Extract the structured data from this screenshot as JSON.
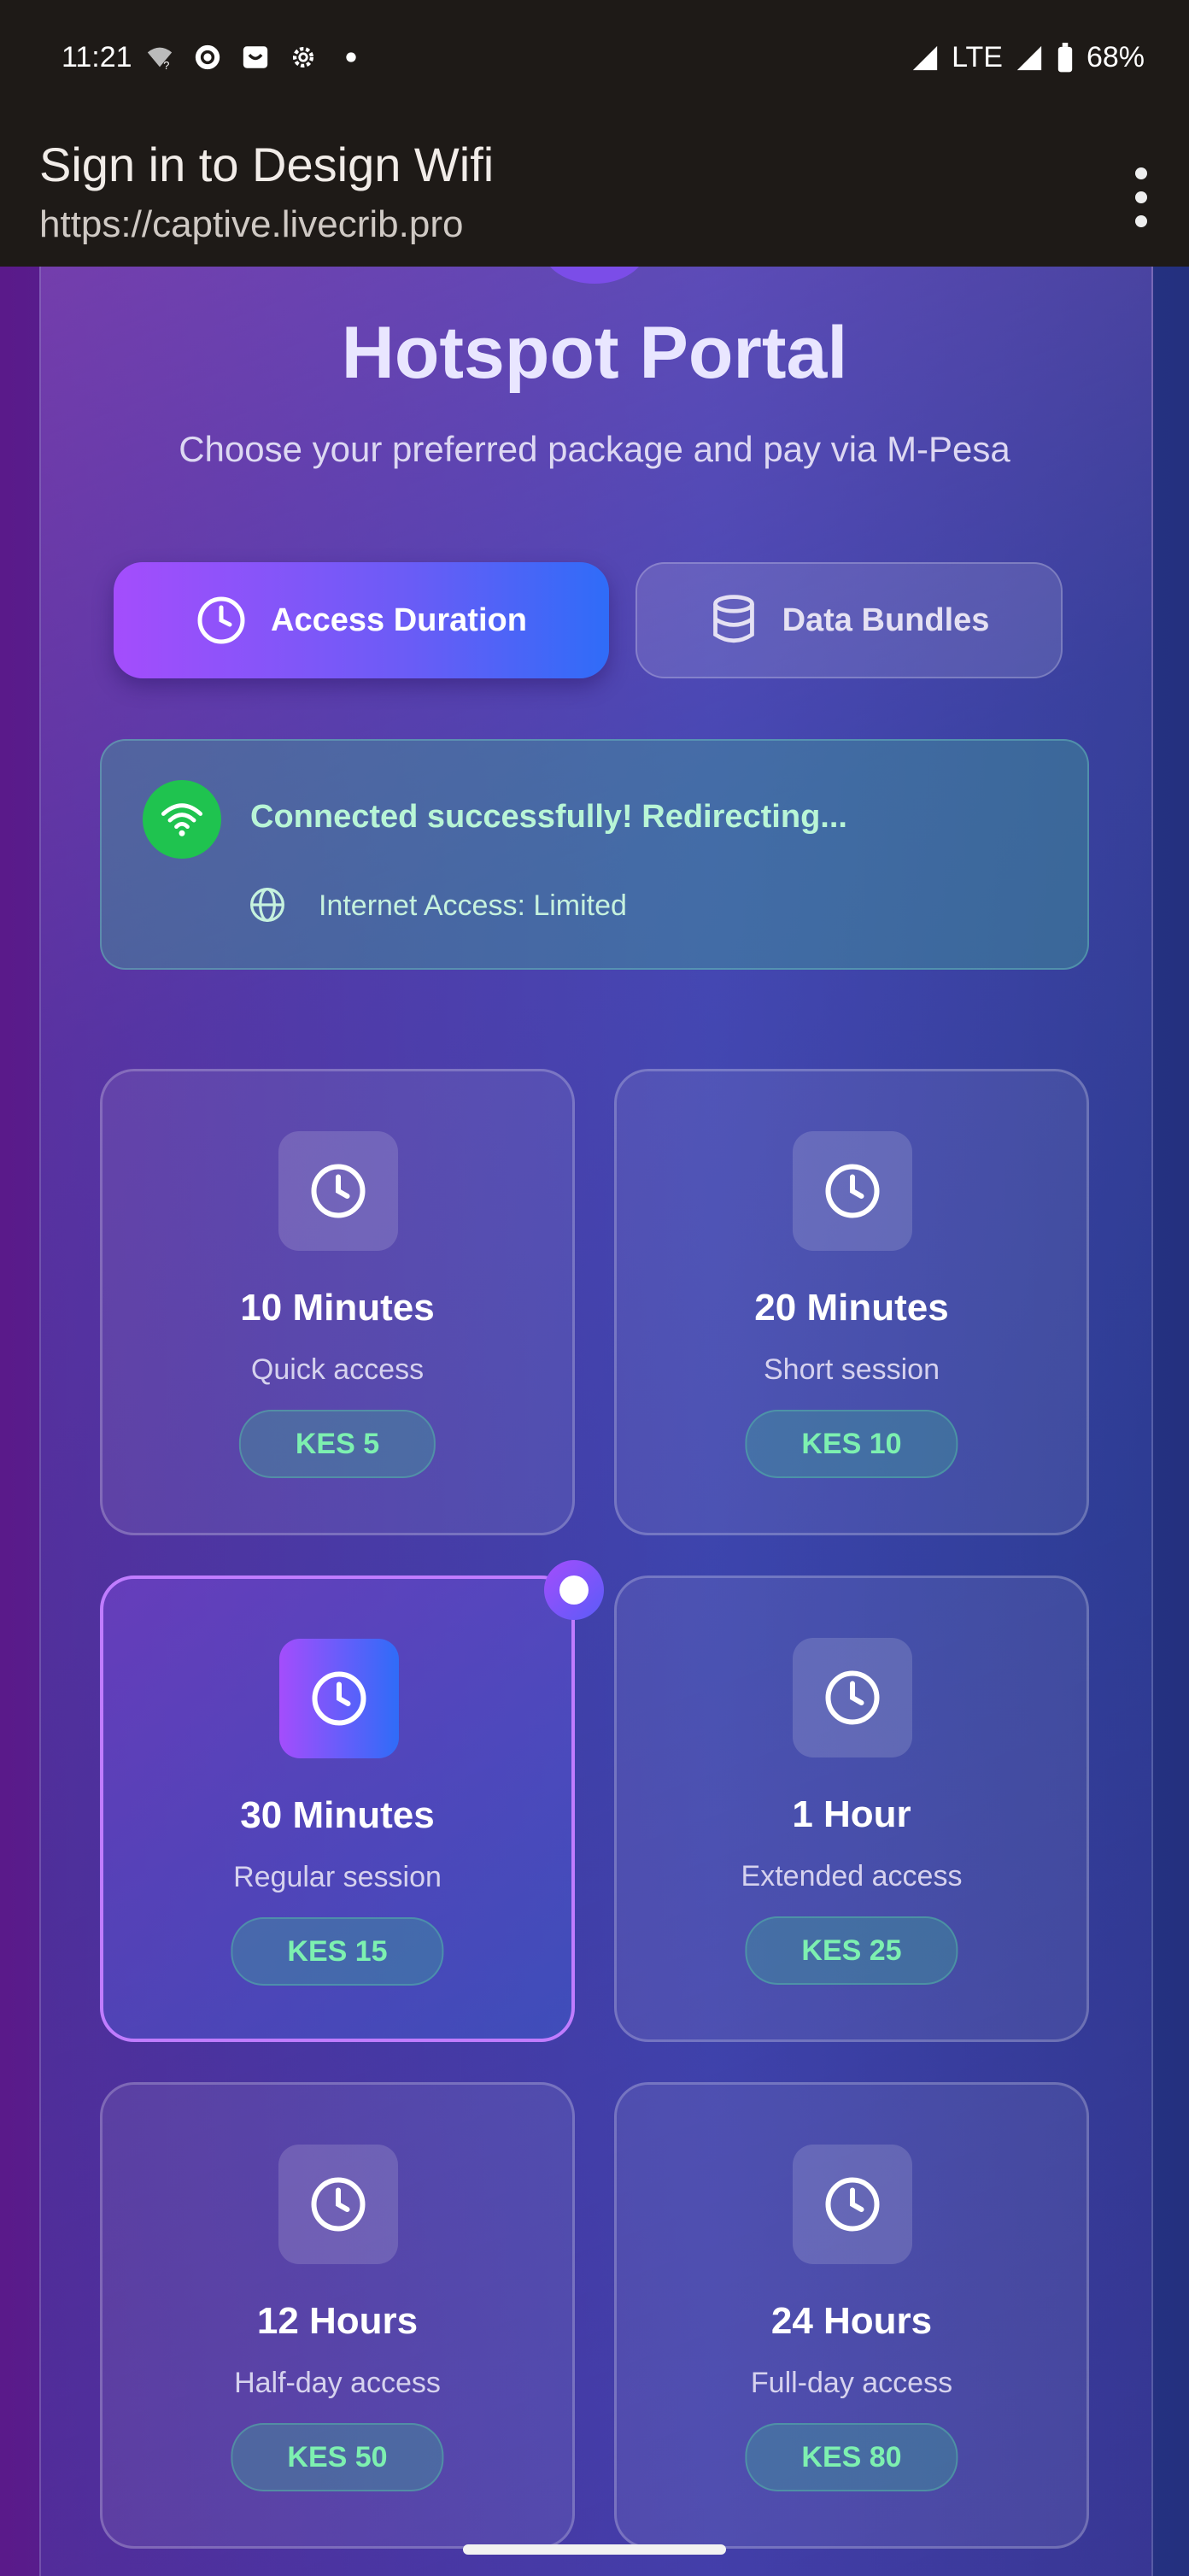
{
  "status_bar": {
    "time": "11:21",
    "network": "LTE",
    "battery": "68%",
    "icons": [
      "wifi-question-icon",
      "circle-icon",
      "shop-icon",
      "gear-icon",
      "dot-icon"
    ]
  },
  "browser": {
    "title": "Sign in to Design Wifi",
    "url": "https://captive.livecrib.pro"
  },
  "portal": {
    "title": "Hotspot Portal",
    "subtitle": "Choose your preferred package and pay via M-Pesa"
  },
  "tabs": [
    {
      "label": "Access Duration",
      "icon": "clock-icon",
      "active": true
    },
    {
      "label": "Data Bundles",
      "icon": "database-icon",
      "active": false
    }
  ],
  "connection": {
    "message": "Connected successfully! Redirecting...",
    "access": "Internet Access: Limited"
  },
  "packages": [
    {
      "name": "10 Minutes",
      "desc": "Quick access",
      "price": "KES 5",
      "selected": false
    },
    {
      "name": "20 Minutes",
      "desc": "Short session",
      "price": "KES 10",
      "selected": false
    },
    {
      "name": "30 Minutes",
      "desc": "Regular session",
      "price": "KES 15",
      "selected": true
    },
    {
      "name": "1 Hour",
      "desc": "Extended access",
      "price": "KES 25",
      "selected": false
    },
    {
      "name": "12 Hours",
      "desc": "Half-day access",
      "price": "KES 50",
      "selected": false
    },
    {
      "name": "24 Hours",
      "desc": "Full-day access",
      "price": "KES 80",
      "selected": false
    }
  ],
  "colors": {
    "accent_start": "#a44dfc",
    "accent_end": "#2f6cf8",
    "success": "#1fc34f",
    "price_text": "#7df0b0"
  }
}
